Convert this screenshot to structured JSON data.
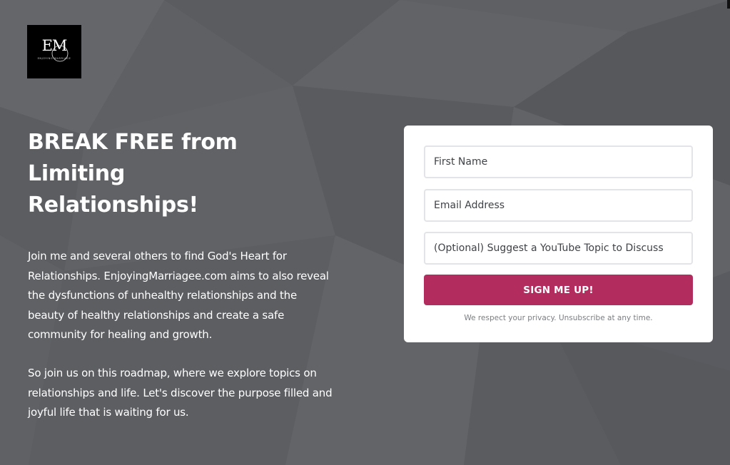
{
  "logo": {
    "monogram": "EM",
    "tagline": "ENJOYING MARRIAGE"
  },
  "hero": {
    "headline": "BREAK FREE from Limiting Relationships!",
    "paragraph_1": "Join me and several others to find God's Heart for Relationships. EnjoyingMarriagee.com aims to also reveal the dysfunctions of unhealthy relationships and the beauty of healthy relationships and create a safe community for healing and growth.",
    "paragraph_2": "So join us on this roadmap, where we explore topics on relationships and life. Let's discover the purpose filled and joyful life that is waiting for us."
  },
  "form": {
    "first_name": {
      "placeholder": "First Name",
      "value": ""
    },
    "email": {
      "placeholder": "Email Address",
      "value": ""
    },
    "topic": {
      "placeholder": "(Optional) Suggest a YouTube Topic to Discuss",
      "value": ""
    },
    "submit_label": "SIGN ME UP!",
    "privacy_note": "We respect your privacy. Unsubscribe at any time."
  },
  "colors": {
    "background": "#5e6064",
    "accent": "#b32c5e",
    "card": "#ffffff",
    "input_border": "#e3e4e8"
  }
}
